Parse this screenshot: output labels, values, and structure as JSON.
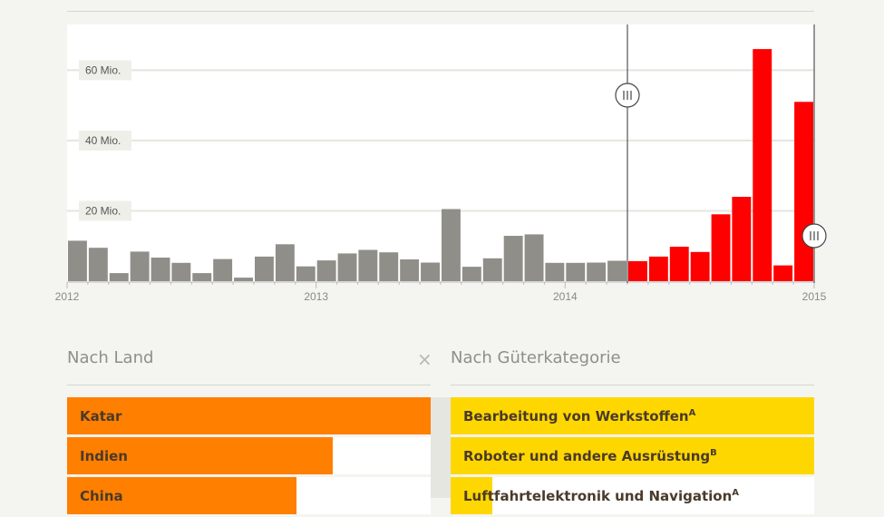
{
  "chart_data": {
    "type": "bar",
    "x_ticks": [
      "2012",
      "2013",
      "2014",
      "2015"
    ],
    "y_ticks": [
      {
        "value": 20000000,
        "label": "20 Mio."
      },
      {
        "value": 40000000,
        "label": "40 Mio."
      },
      {
        "value": 60000000,
        "label": "60 Mio."
      }
    ],
    "ylim": [
      0,
      73000000
    ],
    "xlim": [
      "2012-01",
      "2015-01"
    ],
    "months": [
      "2012-01",
      "2012-02",
      "2012-03",
      "2012-04",
      "2012-05",
      "2012-06",
      "2012-07",
      "2012-08",
      "2012-09",
      "2012-10",
      "2012-11",
      "2012-12",
      "2013-01",
      "2013-02",
      "2013-03",
      "2013-04",
      "2013-05",
      "2013-06",
      "2013-07",
      "2013-08",
      "2013-09",
      "2013-10",
      "2013-11",
      "2013-12",
      "2014-01",
      "2014-02",
      "2014-03",
      "2014-04",
      "2014-05",
      "2014-06",
      "2014-07",
      "2014-08",
      "2014-09",
      "2014-10",
      "2014-11",
      "2014-12"
    ],
    "values": [
      11500000,
      9500000,
      2300000,
      8400000,
      6700000,
      5200000,
      2300000,
      6300000,
      1000000,
      7000000,
      10500000,
      4200000,
      5900000,
      7900000,
      8900000,
      8200000,
      6200000,
      5300000,
      20500000,
      4100000,
      6500000,
      12900000,
      13300000,
      5200000,
      5200000,
      5300000,
      5800000,
      5700000,
      7000000,
      9800000,
      8300000,
      19000000,
      24000000,
      66000000,
      4500000,
      51000000
    ],
    "selected_range": [
      "2014-04",
      "2014-12"
    ],
    "colors": {
      "normal": "#8f8e89",
      "selected": "#ff0000"
    },
    "grid": true
  },
  "panels": {
    "country": {
      "title": "Nach Land",
      "close_label": "×",
      "color": "#ff7f00",
      "items": [
        {
          "label": "Katar",
          "sup": "",
          "share": 1.0
        },
        {
          "label": "Indien",
          "sup": "",
          "share": 0.73
        },
        {
          "label": "China",
          "sup": "",
          "share": 0.63
        }
      ]
    },
    "category": {
      "title": "Nach Güterkategorie",
      "color": "#ffd700",
      "items": [
        {
          "label": "Bearbeitung von Werkstoffen",
          "sup": "A",
          "share": 1.0
        },
        {
          "label": "Roboter und andere Ausrüstung",
          "sup": "B",
          "share": 1.0
        },
        {
          "label": "Luftfahrtelektronik und Navigation",
          "sup": "A",
          "share": 0.115
        }
      ]
    }
  }
}
